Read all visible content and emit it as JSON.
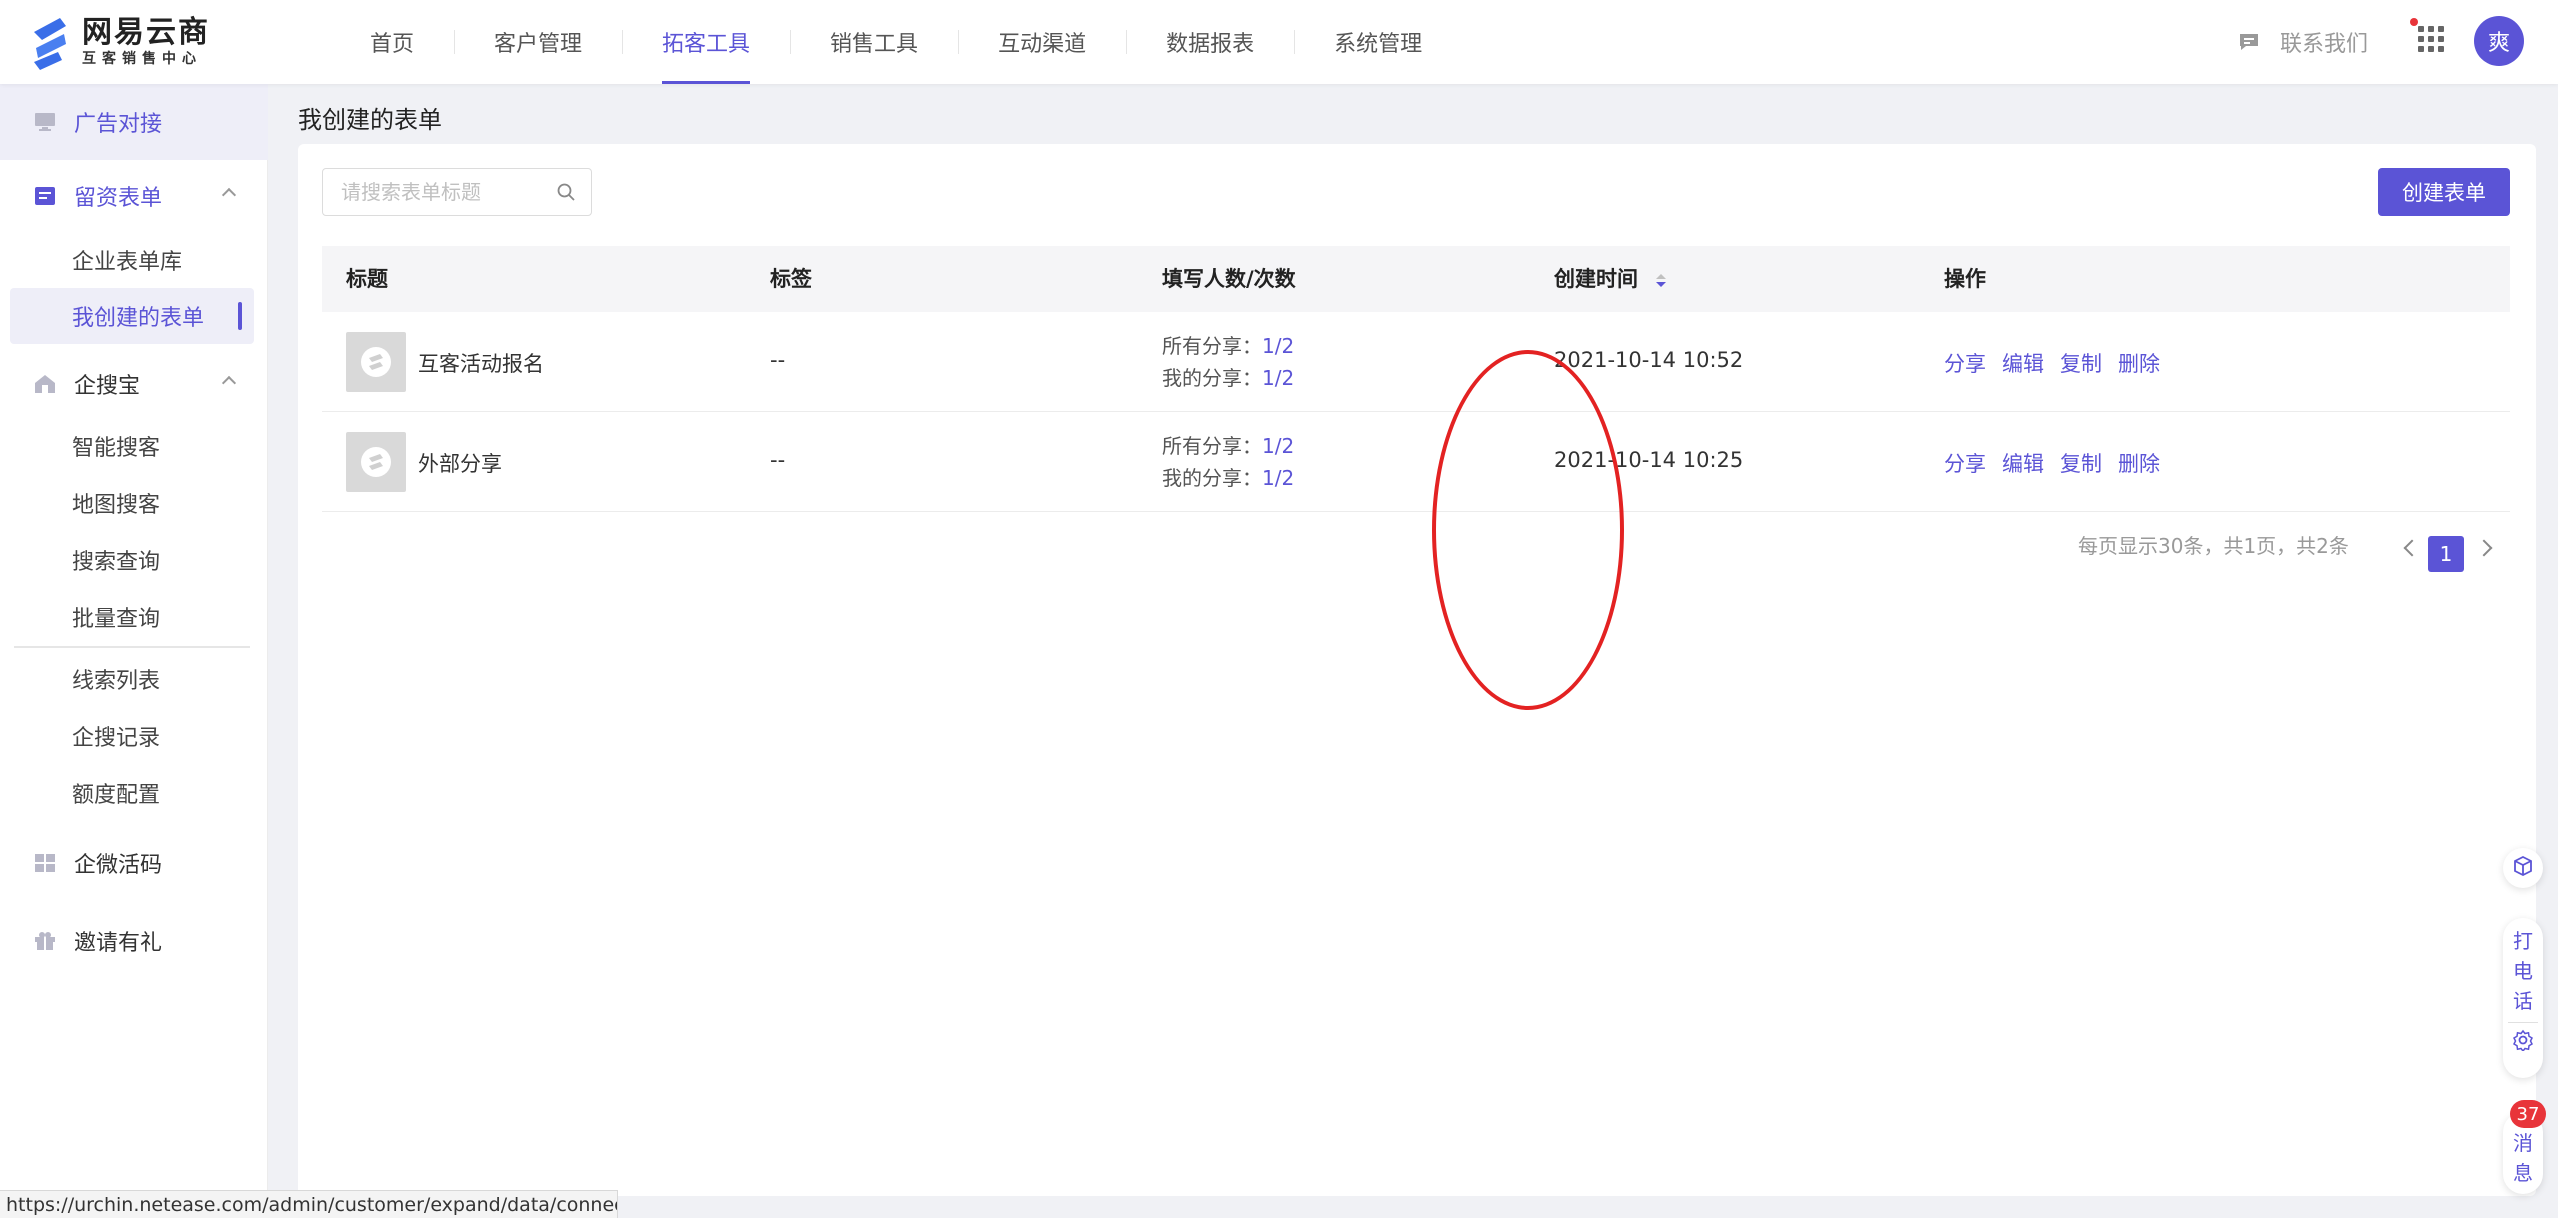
{
  "app": {
    "logo_title": "网易云商",
    "logo_sub": "互客销售中心",
    "avatar_text": "爽"
  },
  "nav": {
    "items": [
      {
        "label": "首页"
      },
      {
        "label": "客户管理"
      },
      {
        "label": "拓客工具",
        "active": true
      },
      {
        "label": "销售工具"
      },
      {
        "label": "互动渠道"
      },
      {
        "label": "数据报表"
      },
      {
        "label": "系统管理"
      }
    ],
    "contact_label": "联系我们"
  },
  "sidebar": {
    "ad": "广告对接",
    "forms_group": "留资表单",
    "forms_sub": [
      "企业表单库",
      "我创建的表单"
    ],
    "qisou_group": "企搜宝",
    "qisou_sub": [
      "智能搜客",
      "地图搜客",
      "搜索查询",
      "批量查询"
    ],
    "qisou_sub2": [
      "线索列表",
      "企搜记录",
      "额度配置"
    ],
    "wechat": "企微活码",
    "invite": "邀请有礼"
  },
  "page": {
    "title": "我创建的表单",
    "search_placeholder": "请搜索表单标题",
    "create_button": "创建表单"
  },
  "table": {
    "headers": [
      "标题",
      "标签",
      "填写人数/次数",
      "创建时间",
      "操作"
    ],
    "stat_all_label": "所有分享：",
    "stat_mine_label": "我的分享：",
    "ops": [
      "分享",
      "编辑",
      "复制",
      "删除"
    ],
    "rows": [
      {
        "title": "互客活动报名",
        "tag": "--",
        "all": "1/2",
        "mine": "1/2",
        "created": "2021-10-14 10:52"
      },
      {
        "title": "外部分享",
        "tag": "--",
        "all": "1/2",
        "mine": "1/2",
        "created": "2021-10-14 10:25"
      }
    ]
  },
  "pagination": {
    "summary": "每页显示30条，共1页，共2条",
    "current": "1"
  },
  "floating": {
    "call": [
      "打",
      "电",
      "话"
    ],
    "msg": [
      "消",
      "息"
    ],
    "msg_badge": "37"
  },
  "status_url": "https://urchin.netease.com/admin/customer/expand/data/connection",
  "colors": {
    "accent": "#5b54d6",
    "annotation_red": "#e32222"
  }
}
